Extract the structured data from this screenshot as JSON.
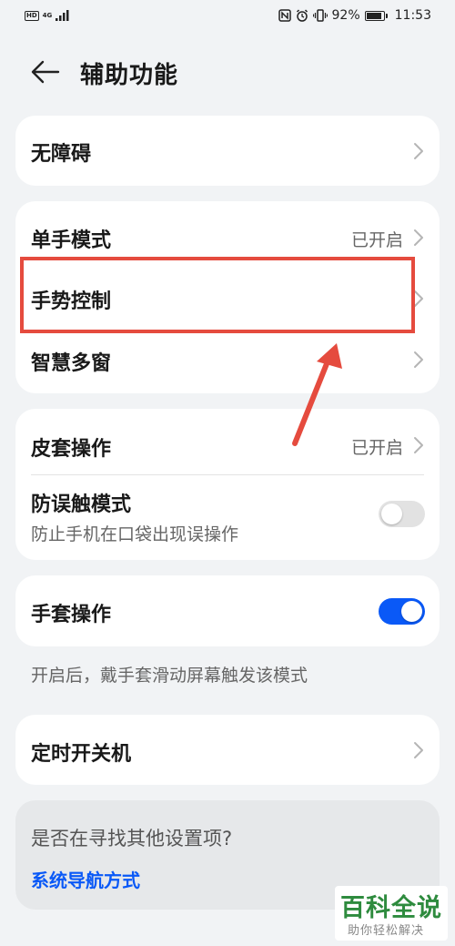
{
  "status_bar": {
    "hd_badge": "HD",
    "network": "4G",
    "battery": "92%",
    "battery_level": 0.92,
    "time": "11:53"
  },
  "header": {
    "title": "辅助功能"
  },
  "card1": {
    "items": [
      {
        "label": "无障碍",
        "value": ""
      }
    ]
  },
  "card2": {
    "items": [
      {
        "label": "单手模式",
        "value": "已开启"
      },
      {
        "label": "手势控制",
        "value": ""
      },
      {
        "label": "智慧多窗",
        "value": ""
      }
    ]
  },
  "card3": {
    "cover": {
      "label": "皮套操作",
      "value": "已开启"
    },
    "anti_touch": {
      "label": "防误触模式",
      "sublabel": "防止手机在口袋出现误操作",
      "enabled": false
    }
  },
  "card4": {
    "glove": {
      "label": "手套操作",
      "enabled": true
    },
    "note": "开启后，戴手套滑动屏幕触发该模式"
  },
  "card5": {
    "items": [
      {
        "label": "定时开关机",
        "value": ""
      }
    ]
  },
  "hint_card": {
    "question": "是否在寻找其他设置项?",
    "link": "系统导航方式"
  },
  "watermark": {
    "title": "百科全说",
    "subtitle": "助你轻松解决"
  },
  "colors": {
    "accent": "#0a59f7",
    "annotation": "#e54b3e",
    "watermark_green": "#2e8b3e"
  }
}
